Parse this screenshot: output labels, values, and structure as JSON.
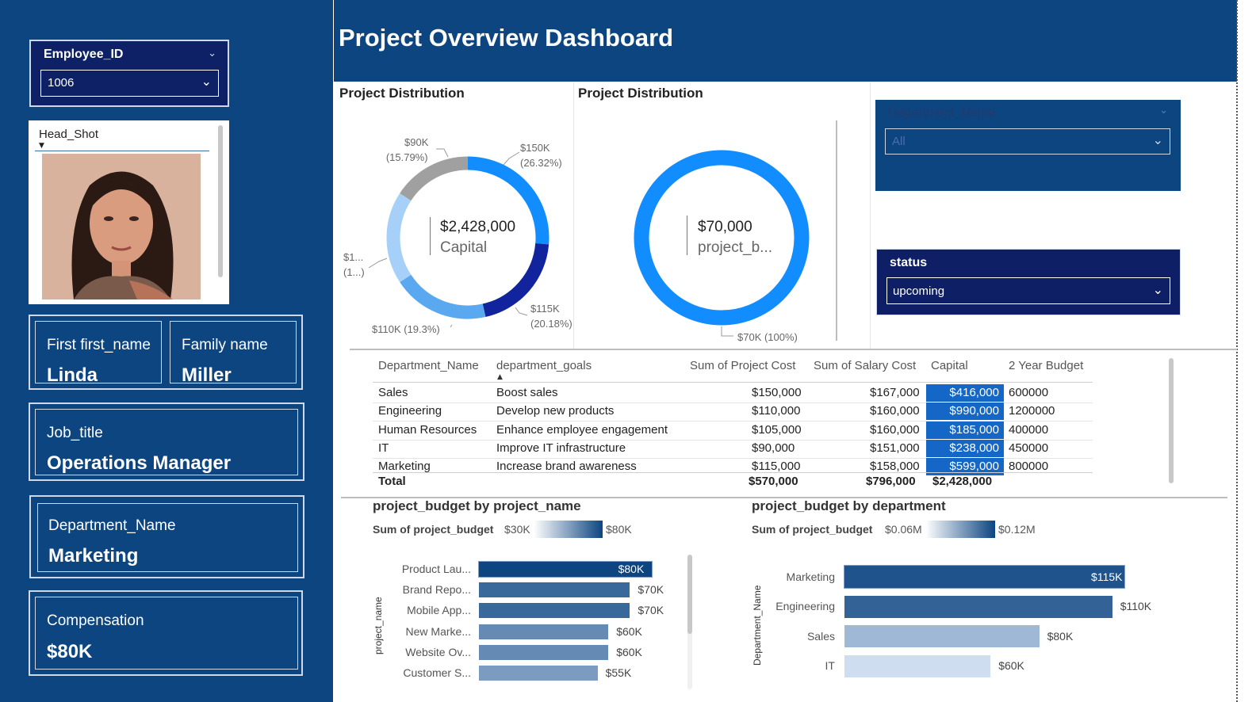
{
  "header": {
    "title": "Project Overview Dashboard"
  },
  "employee_slicer": {
    "title": "Employee_ID",
    "value": "1006"
  },
  "headshot": {
    "title": "Head_Shot"
  },
  "cards": {
    "first_name": {
      "label": "First first_name",
      "value": "Linda"
    },
    "family_name": {
      "label": "Family name",
      "value": "Miller"
    },
    "job_title": {
      "label": "Job_title",
      "value": "Operations Manager"
    },
    "department": {
      "label": "Department_Name",
      "value": "Marketing"
    },
    "compensation": {
      "label": "Compensation",
      "value": "$80K"
    }
  },
  "donut1": {
    "title": "Project Distribution",
    "center_value": "$2,428,000",
    "center_label": "Capital",
    "labels": {
      "a": [
        "$90K",
        "(15.79%)"
      ],
      "b": [
        "$150K",
        "(26.32%)"
      ],
      "c": [
        "$1...",
        "(1...)"
      ],
      "d": [
        "$115K",
        "(20.18%)"
      ],
      "e": [
        "$110K (19.3%)"
      ]
    }
  },
  "donut2": {
    "title": "Project Distribution",
    "center_value": "$70,000",
    "center_label": "project_b...",
    "label": "$70K (100%)"
  },
  "dept_slicer": {
    "title": "Department_Name",
    "value": "All"
  },
  "status_slicer": {
    "title": "status",
    "value": "upcoming"
  },
  "table": {
    "headers": [
      "Department_Name",
      "department_goals",
      "Sum of Project Cost",
      "Sum of Salary Cost",
      "Capital",
      "2 Year Budget"
    ],
    "rows": [
      [
        "Sales",
        "Boost sales",
        "$150,000",
        "$167,000",
        "$416,000",
        "600000"
      ],
      [
        "Engineering",
        "Develop new products",
        "$110,000",
        "$160,000",
        "$990,000",
        "1200000"
      ],
      [
        "Human Resources",
        "Enhance employee engagement",
        "$105,000",
        "$160,000",
        "$185,000",
        "400000"
      ],
      [
        "IT",
        "Improve IT infrastructure",
        "$90,000",
        "$151,000",
        "$238,000",
        "450000"
      ],
      [
        "Marketing",
        "Increase brand awareness",
        "$115,000",
        "$158,000",
        "$599,000",
        "800000"
      ]
    ],
    "total": [
      "Total",
      "$570,000",
      "$796,000",
      "$2,428,000"
    ]
  },
  "bar1": {
    "title": "project_budget by project_name",
    "legend_title": "Sum of project_budget",
    "legend_min": "$30K",
    "legend_max": "$80K",
    "axis_title": "project_name"
  },
  "bar2": {
    "title": "project_budget by department",
    "legend_title": "Sum of project_budget",
    "legend_min": "$0.06M",
    "legend_max": "$0.12M",
    "axis_title": "Department_Name"
  },
  "chart_data": [
    {
      "type": "pie",
      "title": "Project Distribution",
      "center_value": "$2,428,000",
      "center_label": "Capital",
      "slices": [
        {
          "label": "$150K",
          "value": 150,
          "percent": 26.32,
          "color": "#118dff"
        },
        {
          "label": "$115K",
          "value": 115,
          "percent": 20.18,
          "color": "#12239e"
        },
        {
          "label": "$110K",
          "value": 110,
          "percent": 19.3,
          "color": "#5aa9f0"
        },
        {
          "label": "$1...",
          "value": 105,
          "percent": 18.42,
          "color": "#a6d0f7"
        },
        {
          "label": "$90K",
          "value": 90,
          "percent": 15.79,
          "color": "#a0a0a0"
        }
      ]
    },
    {
      "type": "pie",
      "title": "Project Distribution",
      "center_value": "$70,000",
      "center_label": "project_b...",
      "slices": [
        {
          "label": "$70K",
          "value": 70,
          "percent": 100,
          "color": "#118dff"
        }
      ]
    },
    {
      "type": "bar",
      "title": "project_budget by project_name",
      "categories": [
        "Product Lau...",
        "Brand Repo...",
        "Mobile App...",
        "New Marke...",
        "Website Ov...",
        "Customer S..."
      ],
      "values": [
        80,
        70,
        70,
        60,
        60,
        55
      ],
      "value_labels": [
        "$80K",
        "$70K",
        "$70K",
        "$60K",
        "$60K",
        "$55K"
      ],
      "color_range": [
        "#ffffff",
        "#0d4581"
      ],
      "color_domain": [
        30,
        80
      ]
    },
    {
      "type": "bar",
      "title": "project_budget by department",
      "categories": [
        "Marketing",
        "Engineering",
        "Sales",
        "IT"
      ],
      "values": [
        115,
        110,
        80,
        60
      ],
      "value_labels": [
        "$115K",
        "$110K",
        "$80K",
        "$60K"
      ],
      "color_range": [
        "#ffffff",
        "#0d4581"
      ],
      "color_domain": [
        60,
        120
      ]
    }
  ]
}
